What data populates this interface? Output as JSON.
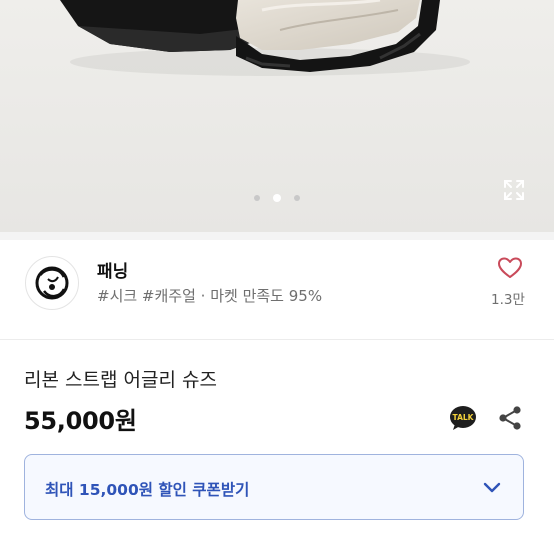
{
  "product_image": {
    "carousel_dots": 3,
    "active_dot": 1,
    "expand_icon": "expand-icon"
  },
  "shop": {
    "name": "패닝",
    "tags": "#시크 #캐주얼 · 마켓 만족도 95%",
    "like_count": "1.3만",
    "logo_icon": "shop-logo"
  },
  "product": {
    "title": "리본 스트랩 어글리 슈즈",
    "price": "55,000원"
  },
  "actions": {
    "talk_icon_label": "TALK",
    "share_icon": "share-icon"
  },
  "coupon": {
    "label": "최대 15,000원 할인 쿠폰받기",
    "chevron_icon": "chevron-down-icon"
  },
  "colors": {
    "accent": "#2f54b8",
    "like": "#c94a5a",
    "coupon_border": "#9fb3de"
  }
}
